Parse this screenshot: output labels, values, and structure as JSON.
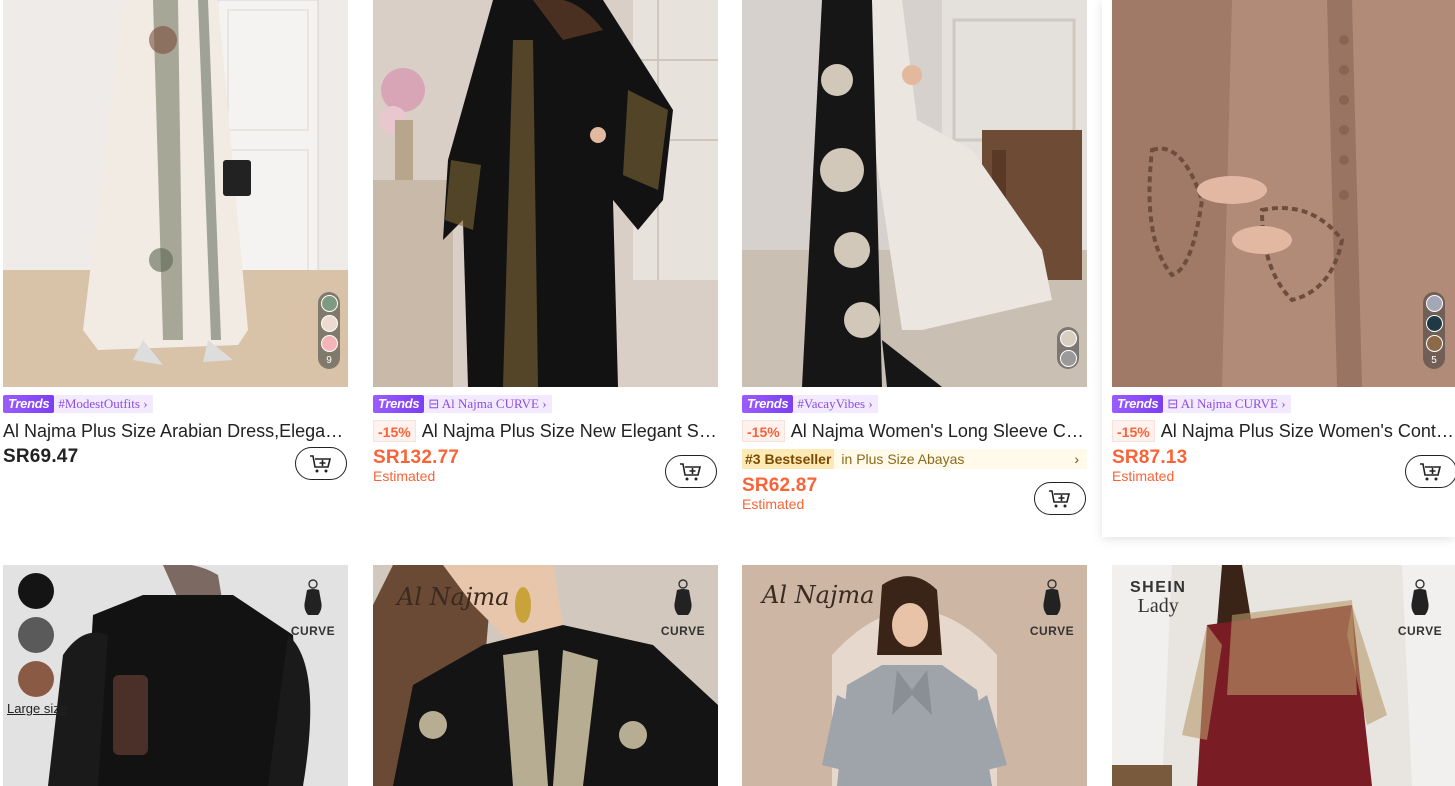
{
  "products": [
    {
      "id": "p1",
      "badge": "Trends",
      "tag": "#ModestOutfits",
      "tag_arrow": "›",
      "title": "Al Najma Plus Size Arabian Dress,Elegant ...",
      "discount": "",
      "price": "SR69.47",
      "estimated": "",
      "swatch_colors": [
        "#7f9a82",
        "#ecd9cf",
        "#f4b5b8"
      ],
      "swatch_count": "9"
    },
    {
      "id": "p2",
      "badge": "Trends",
      "tag": "Al Najma CURVE",
      "tag_arrow": "›",
      "title": "Al Najma Plus Size New Elegant Stan...",
      "discount": "-15%",
      "price": "SR132.77",
      "estimated": "Estimated"
    },
    {
      "id": "p3",
      "badge": "Trends",
      "tag": "#VacayVibes",
      "tag_arrow": "›",
      "title": "Al Najma Women's Long Sleeve Chif...",
      "discount": "-15%",
      "bestseller_rank": "#3 Bestseller",
      "bestseller_category": "in Plus Size Abayas",
      "bestseller_arrow": "›",
      "price": "SR62.87",
      "estimated": "Estimated",
      "swatch_colors": [
        "#d8cfc0",
        "#9a9a9a"
      ]
    },
    {
      "id": "p4",
      "badge": "Trends",
      "tag": "Al Najma CURVE",
      "tag_arrow": "›",
      "title": "Al Najma Plus Size Women's Contra...",
      "discount": "-15%",
      "price": "SR87.13",
      "estimated": "Estimated",
      "swatch_colors": [
        "#a4a7b6",
        "#1f3a46",
        "#8c6a48"
      ],
      "swatch_count": "5"
    }
  ],
  "row2": [
    {
      "id": "p5",
      "left_colors": [
        "#141414",
        "#5a5a5a",
        "#8b5a44"
      ],
      "left_label": "Large size",
      "logo": "CURVE"
    },
    {
      "id": "p6",
      "script_logo": "Al Najma",
      "logo": "CURVE"
    },
    {
      "id": "p7",
      "script_logo": "Al Najma",
      "logo": "CURVE"
    },
    {
      "id": "p8",
      "brand_top": "SHEIN",
      "brand_bottom": "Lady",
      "logo": "CURVE"
    }
  ],
  "colors": {
    "accent_red": "#fa6338",
    "trends_purple": "#8a4fe0",
    "bestseller_bg": "#fffaea"
  },
  "icons": {
    "cart": "add-to-cart-icon",
    "store": "store-icon",
    "curve": "curve-figure-icon"
  }
}
